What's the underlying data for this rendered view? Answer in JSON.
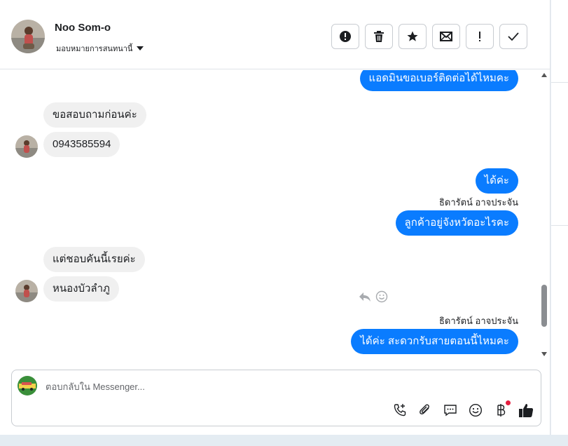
{
  "contact": {
    "name": "Noo Som-o",
    "assign_label": "มอบหมายการสนทนานี้"
  },
  "header_actions": [
    {
      "icon": "alert-circle-icon",
      "name": "mark-spam-button"
    },
    {
      "icon": "trash-icon",
      "name": "delete-button"
    },
    {
      "icon": "star-icon",
      "name": "star-button"
    },
    {
      "icon": "envelope-icon",
      "name": "mark-unread-button"
    },
    {
      "icon": "exclamation-icon",
      "name": "follow-up-button"
    },
    {
      "icon": "check-icon",
      "name": "mark-done-button"
    }
  ],
  "messages": {
    "m1": "แอดมินขอเบอร์ติดต่อได้ไหมคะ",
    "m2": "ขอสอบถามก่อนค่ะ",
    "m3": "0943585594",
    "m4": "ได้ค่ะ",
    "sender1": "ธิดารัตน์ อาจประจัน",
    "m5": "ลูกค้าอยู่จังหวัดอะไรคะ",
    "m6": "แต่ชอบคันนี้เรยค่ะ",
    "m7": "หนองบัวลำภู",
    "sender2": "ธิดารัตน์ อาจประจัน",
    "m8": "ได้ค่ะ สะดวกรับสายตอนนี้ไหมคะ"
  },
  "composer": {
    "placeholder": "ตอบกลับใน Messenger..."
  },
  "colors": {
    "outgoing": "#0a7cff",
    "incoming": "#f0f0f0",
    "like": "#1c1e21",
    "notification_dot": "#e41e3f"
  }
}
